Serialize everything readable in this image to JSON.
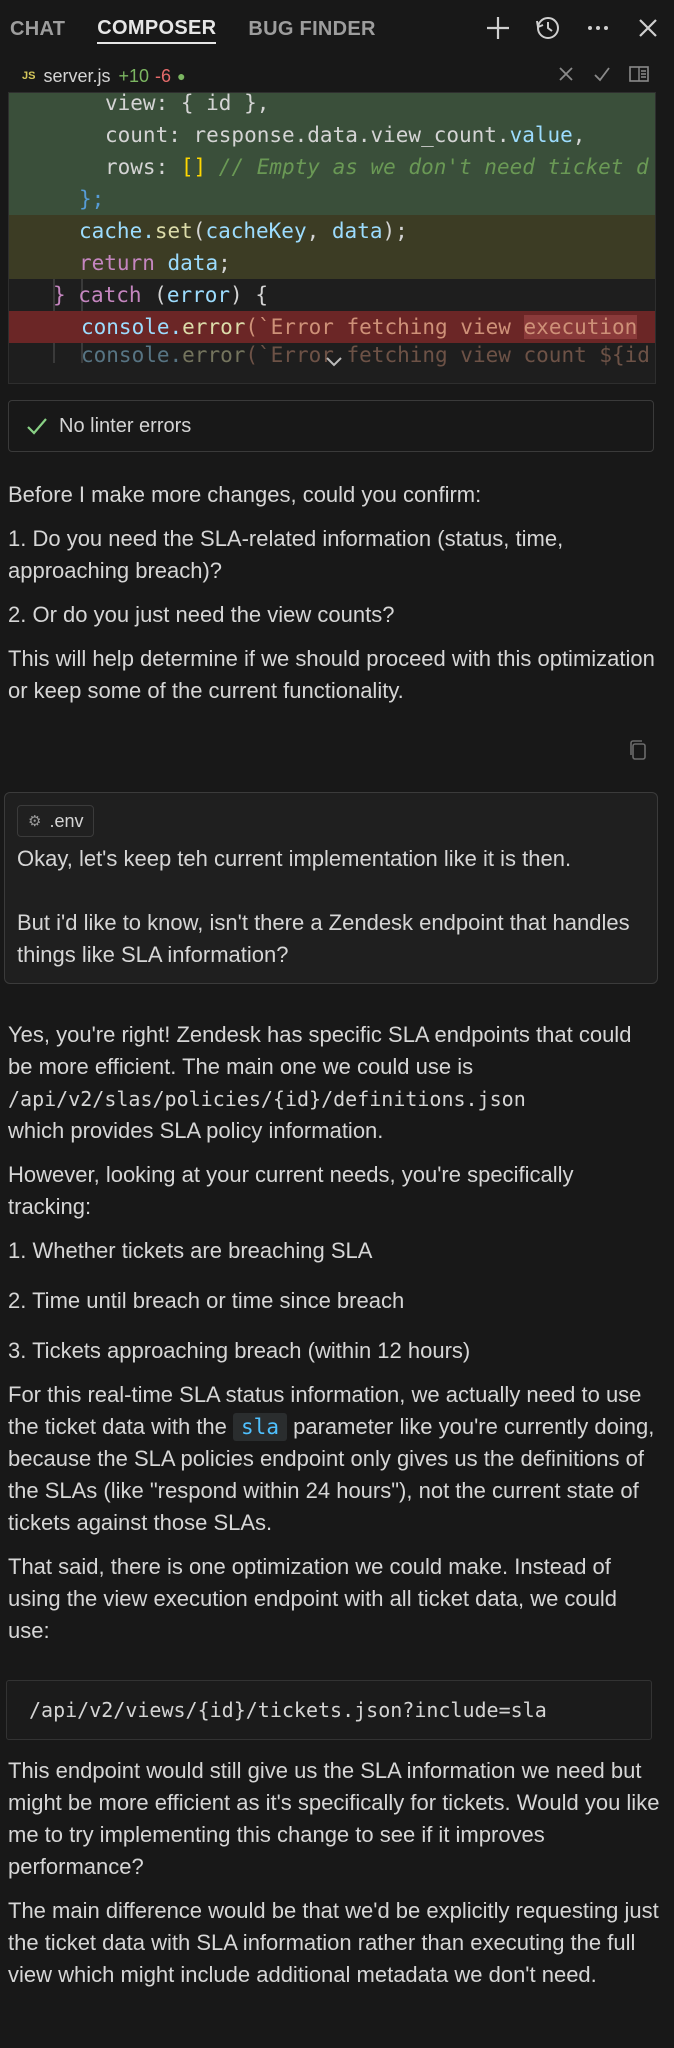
{
  "tabs": [
    {
      "label": "CHAT"
    },
    {
      "label": "COMPOSER"
    },
    {
      "label": "BUG FINDER"
    }
  ],
  "file": {
    "badge": "JS",
    "name": "server.js",
    "additions": "+10",
    "deletions": "-6"
  },
  "code": {
    "line1": {
      "a": "view: { id },"
    },
    "line2": {
      "a": "count: response.data.view_count.",
      "b": "value",
      "c": ","
    },
    "line3": {
      "a": "rows: ",
      "b": "[]",
      "c": " // Empty as we don't need ticket d"
    },
    "line4": {
      "a": "};"
    },
    "line5": {
      "a": "cache.",
      "b": "set",
      "c": "(",
      "d": "cacheKey",
      "e": ", ",
      "f": "data",
      "g": ");"
    },
    "line6": {
      "a": "return ",
      "b": "data",
      "c": ";"
    },
    "line7": {
      "a": "} ",
      "b": "catch",
      "c": " (",
      "d": "error",
      "e": ") {"
    },
    "line8": {
      "a": "console.",
      "b": "error",
      "c": "(`Error fetching view ",
      "d": "execution"
    },
    "line9": {
      "a": "console.",
      "b": "error",
      "c": "(`Error fetching view count ${id"
    }
  },
  "linter": {
    "text": "No linter errors"
  },
  "assistant1": {
    "p1": "Before I make more changes, could you confirm:",
    "p2": "1. Do you need the SLA-related information (status, time, approaching breach)?",
    "p3": "2. Or do you just need the view counts?",
    "p4": "This will help determine if we should proceed with this optimization or keep some of the current functionality."
  },
  "user": {
    "chip": ".env",
    "p1": "Okay, let's keep teh current implementation like it is then.",
    "p2": "But i'd like to know, isn't there a Zendesk endpoint that handles things like SLA information?"
  },
  "assistant2": {
    "p1a": "Yes, you're right! Zendesk has specific SLA endpoints that could be more efficient. The main one we could use is",
    "p1code": "/api/v2/slas/policies/{id}/definitions.json",
    "p1b": "which provides SLA policy information.",
    "p2": "However, looking at your current needs, you're specifically tracking:",
    "p3": "1. Whether tickets are breaching SLA",
    "p4": "2. Time until breach or time since breach",
    "p5": "3. Tickets approaching breach (within 12 hours)",
    "p6a": "For this real-time SLA status information, we actually need to use the ticket data with the",
    "p6code": "sla",
    "p6b": "parameter like you're currently doing, because the SLA policies endpoint only gives us the definitions of the SLAs (like \"respond within 24 hours\"), not the current state of tickets against those SLAs.",
    "p7": "That said, there is one optimization we could make. Instead of using the view execution endpoint with all ticket data, we could use:",
    "codeblock": "/api/v2/views/{id}/tickets.json?include=sla",
    "p8": "This endpoint would still give us the SLA information we need but might be more efficient as it's specifically for tickets. Would you like me to try implementing this change to see if it improves performance?",
    "p9": "The main difference would be that we'd be explicitly requesting just the ticket data with SLA information rather than executing the full view which might include additional metadata we don't need."
  }
}
